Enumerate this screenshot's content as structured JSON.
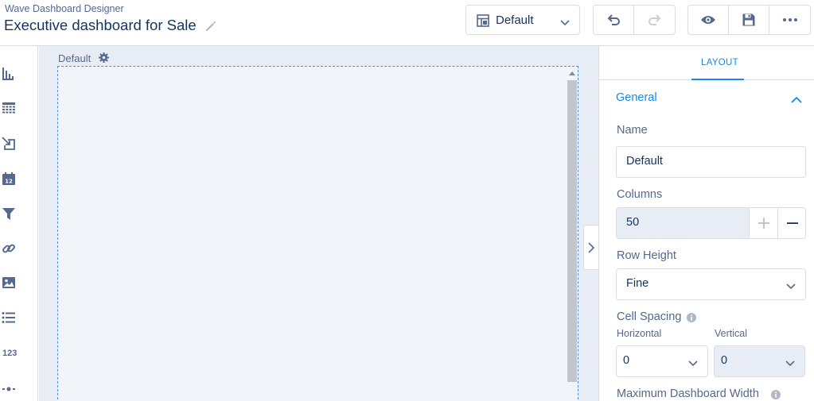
{
  "header": {
    "app_name": "Wave Dashboard Designer",
    "dashboard_title": "Executive dashboard for Sale",
    "layout_selector": {
      "value": "Default"
    },
    "icons": {
      "edit": "pencil-icon",
      "layout": "layout-grid-icon",
      "undo": "undo-icon",
      "redo": "redo-icon",
      "preview": "eye-icon",
      "save": "floppy-disk-icon",
      "more": "ellipsis-icon"
    }
  },
  "toolbar": {
    "items": [
      {
        "name": "chart-widget",
        "icon": "bar-chart-icon"
      },
      {
        "name": "table-widget",
        "icon": "table-grid-icon"
      },
      {
        "name": "toggle-widget",
        "icon": "arrow-into-box-icon"
      },
      {
        "name": "date-widget",
        "icon": "calendar-icon",
        "text": "12"
      },
      {
        "name": "filter-widget",
        "icon": "funnel-icon"
      },
      {
        "name": "link-widget",
        "icon": "chain-link-icon"
      },
      {
        "name": "image-widget",
        "icon": "image-icon"
      },
      {
        "name": "list-widget",
        "icon": "bulleted-list-icon"
      },
      {
        "name": "number-widget",
        "text": "123"
      },
      {
        "name": "range-widget",
        "icon": "slider-icon"
      }
    ]
  },
  "canvas": {
    "page_name": "Default"
  },
  "panel": {
    "tab_label": "LAYOUT",
    "section_title": "General",
    "name_label": "Name",
    "name_value": "Default",
    "columns_label": "Columns",
    "columns_value": "50",
    "row_height_label": "Row Height",
    "row_height_value": "Fine",
    "cell_spacing_label": "Cell Spacing",
    "horizontal_label": "Horizontal",
    "horizontal_value": "0",
    "vertical_label": "Vertical",
    "vertical_value": "0",
    "max_width_label": "Maximum Dashboard Width"
  },
  "colors": {
    "accent": "#1589ee",
    "text_dark": "#16325c",
    "text_muted": "#54698d",
    "border": "#d8dde6",
    "canvas_bg": "#e8edf5"
  }
}
